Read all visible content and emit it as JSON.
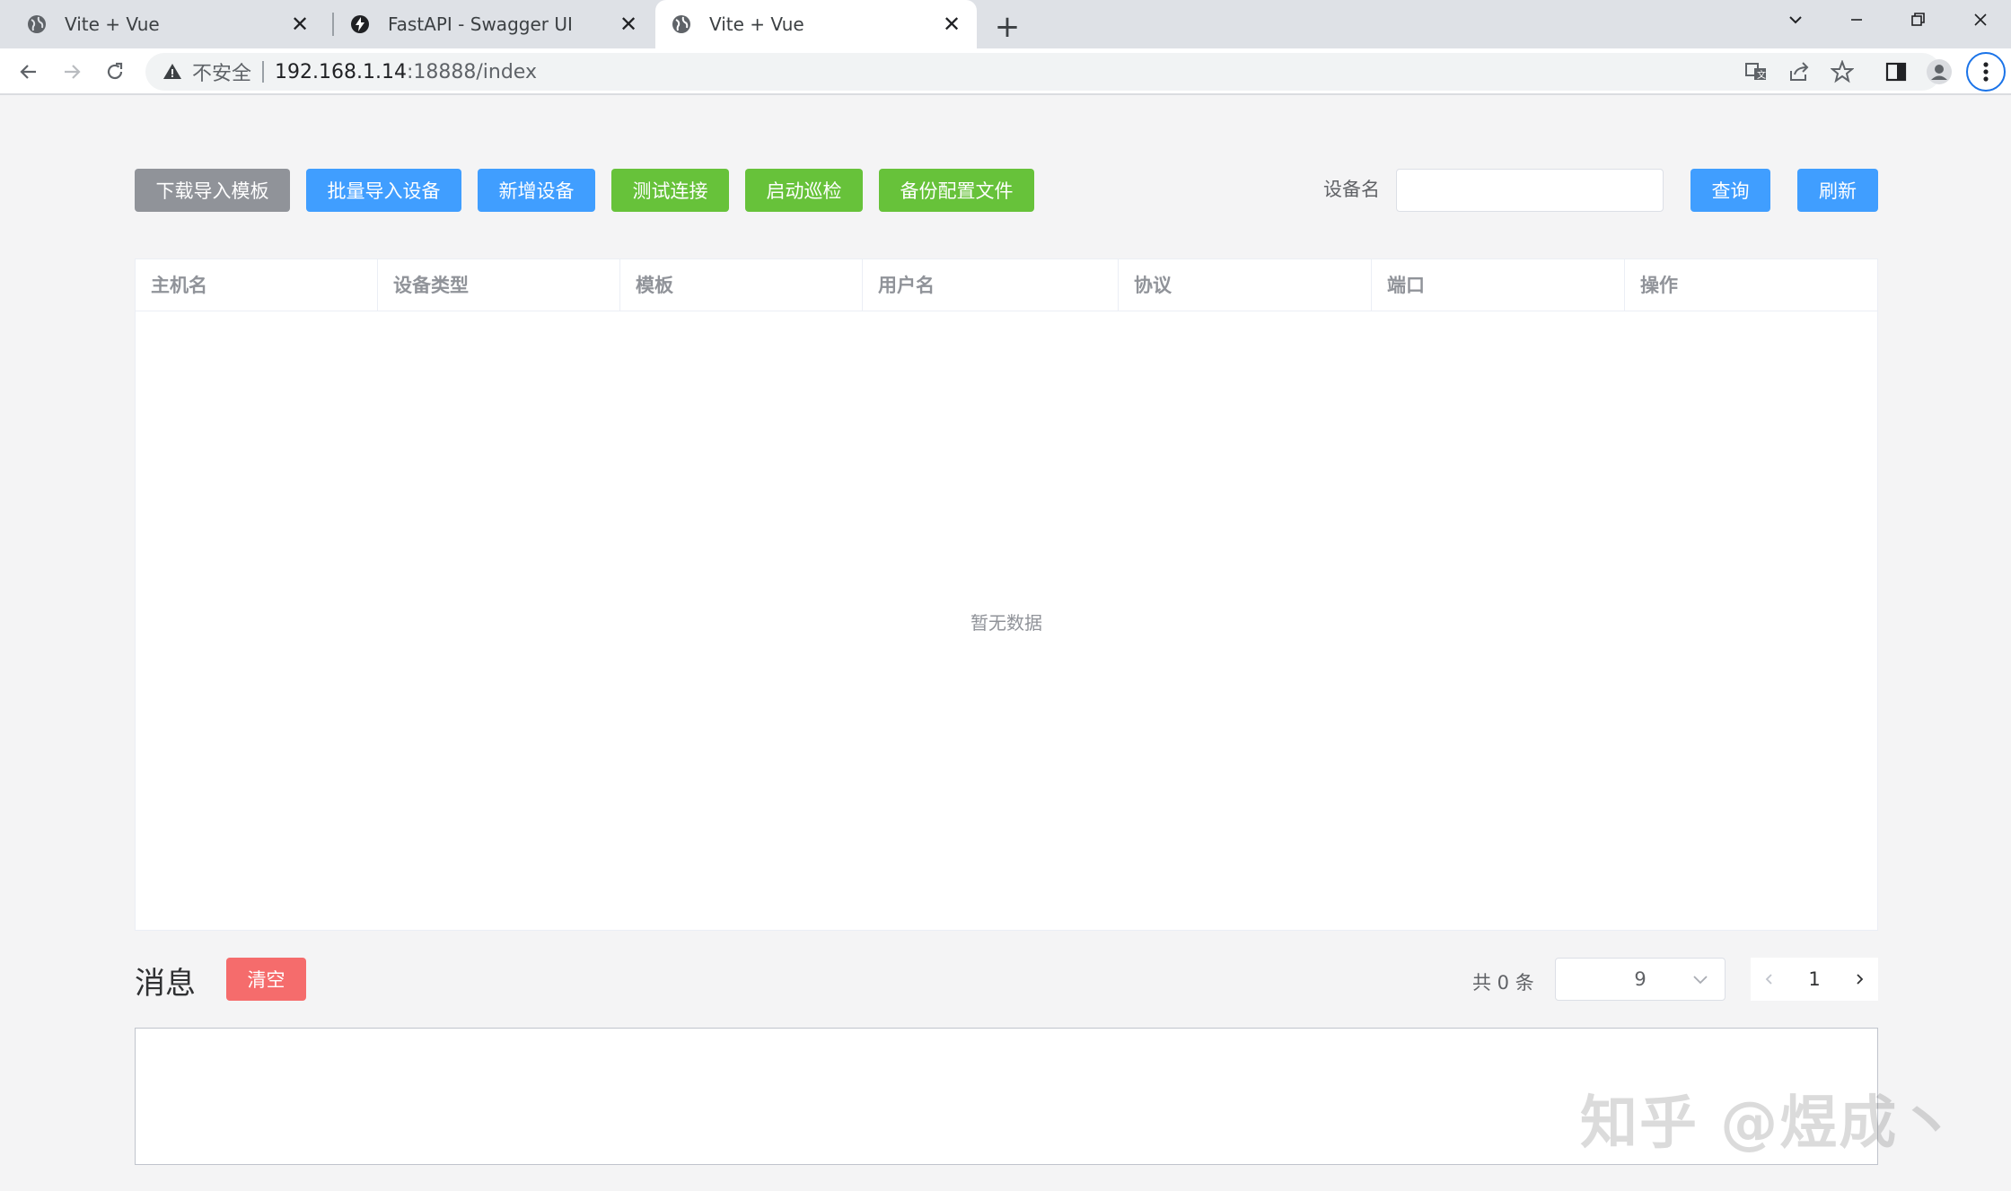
{
  "browser": {
    "tabs": [
      {
        "title": "Vite + Vue",
        "icon": "globe-icon",
        "active": false
      },
      {
        "title": "FastAPI - Swagger UI",
        "icon": "fastapi-icon",
        "active": false
      },
      {
        "title": "Vite + Vue",
        "icon": "globe-icon",
        "active": true
      }
    ],
    "address": {
      "security_label": "不安全",
      "host": "192.168.1.14",
      "rest": ":18888/index"
    }
  },
  "toolbar": {
    "download_template": "下载导入模板",
    "batch_import": "批量导入设备",
    "add_device": "新增设备",
    "test_connection": "测试连接",
    "start_inspection": "启动巡检",
    "backup_config": "备份配置文件"
  },
  "filter": {
    "device_name_label": "设备名",
    "device_name_value": "",
    "query": "查询",
    "refresh": "刷新"
  },
  "table": {
    "columns": [
      "主机名",
      "设备类型",
      "模板",
      "用户名",
      "协议",
      "端口",
      "操作"
    ],
    "rows": [],
    "empty_text": "暂无数据"
  },
  "messages": {
    "title": "消息",
    "clear": "清空",
    "content": ""
  },
  "pagination": {
    "total_text": "共 0 条",
    "page_size": "9",
    "current_page": "1"
  },
  "watermark": "知乎 @煜成丶",
  "colors": {
    "primary": "#409eff",
    "success": "#67c23a",
    "info": "#909399",
    "danger": "#f56c6c"
  }
}
